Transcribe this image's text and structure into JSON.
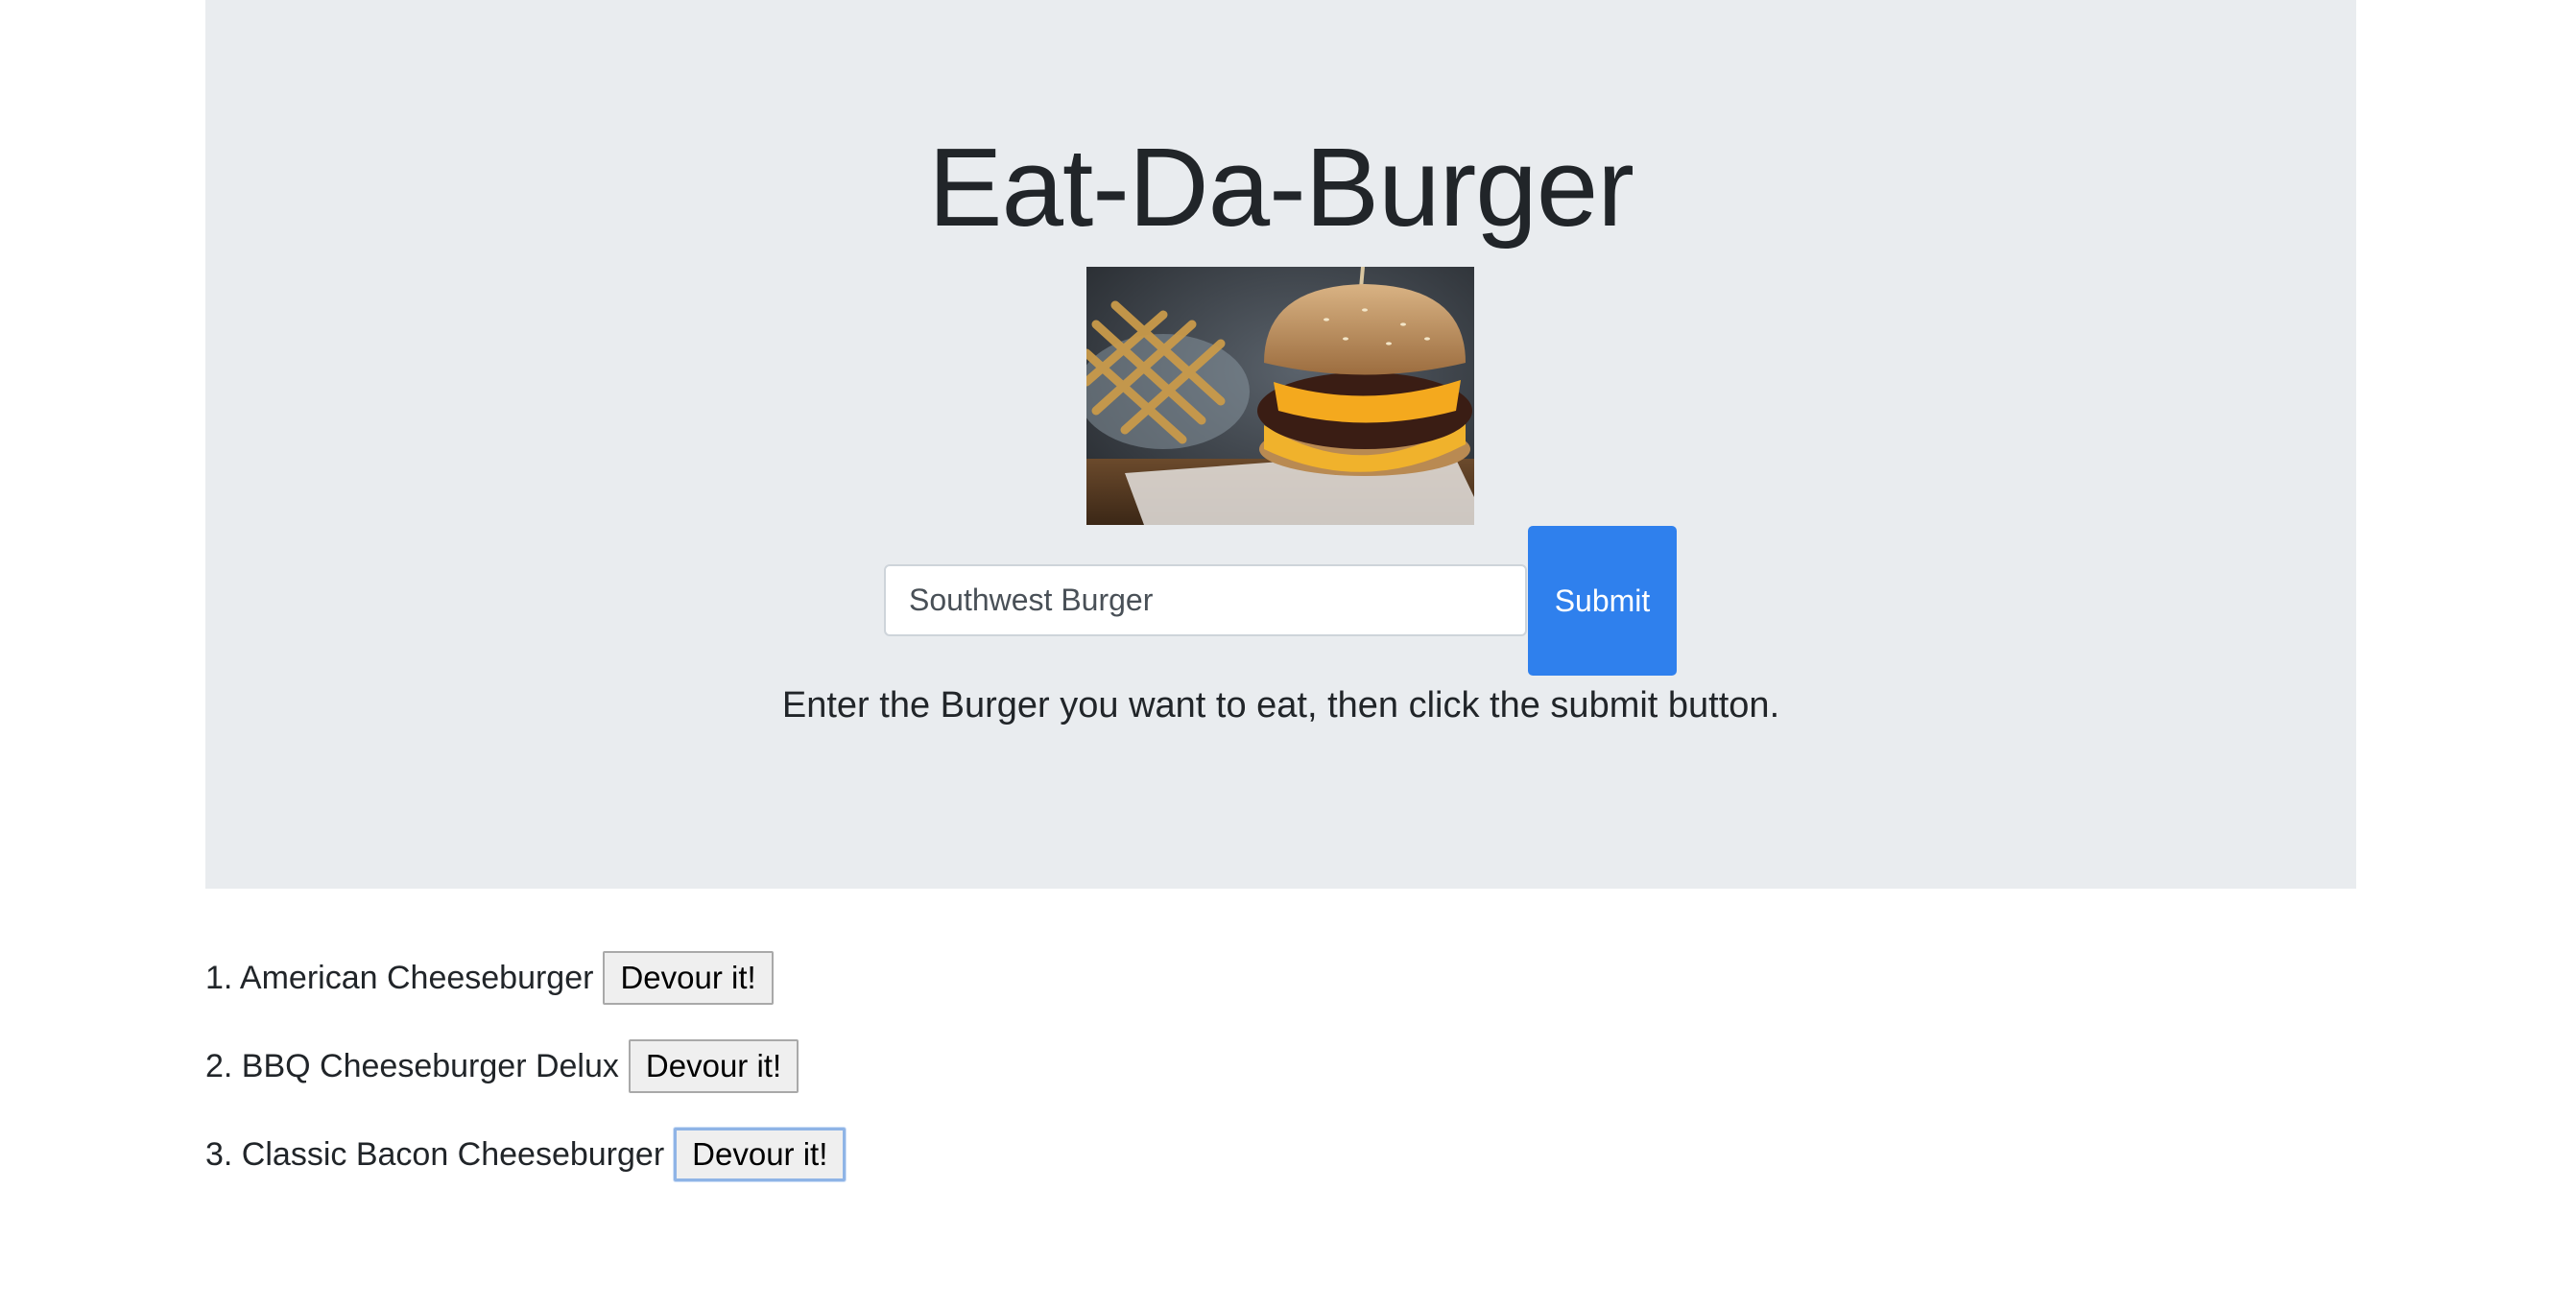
{
  "header": {
    "title": "Eat-Da-Burger",
    "image_icon": "burger-photo"
  },
  "form": {
    "input_value": "Southwest Burger",
    "submit_label": "Submit",
    "instruction": "Enter the Burger you want to eat, then click the submit button."
  },
  "burgers": [
    {
      "label": "1. American Cheeseburger",
      "button": "Devour it!"
    },
    {
      "label": "2. BBQ Cheeseburger Delux",
      "button": "Devour it!"
    },
    {
      "label": "3. Classic Bacon Cheeseburger",
      "button": "Devour it!"
    }
  ],
  "colors": {
    "jumbotron": "#e9ecef",
    "primary": "#2f80ed"
  }
}
